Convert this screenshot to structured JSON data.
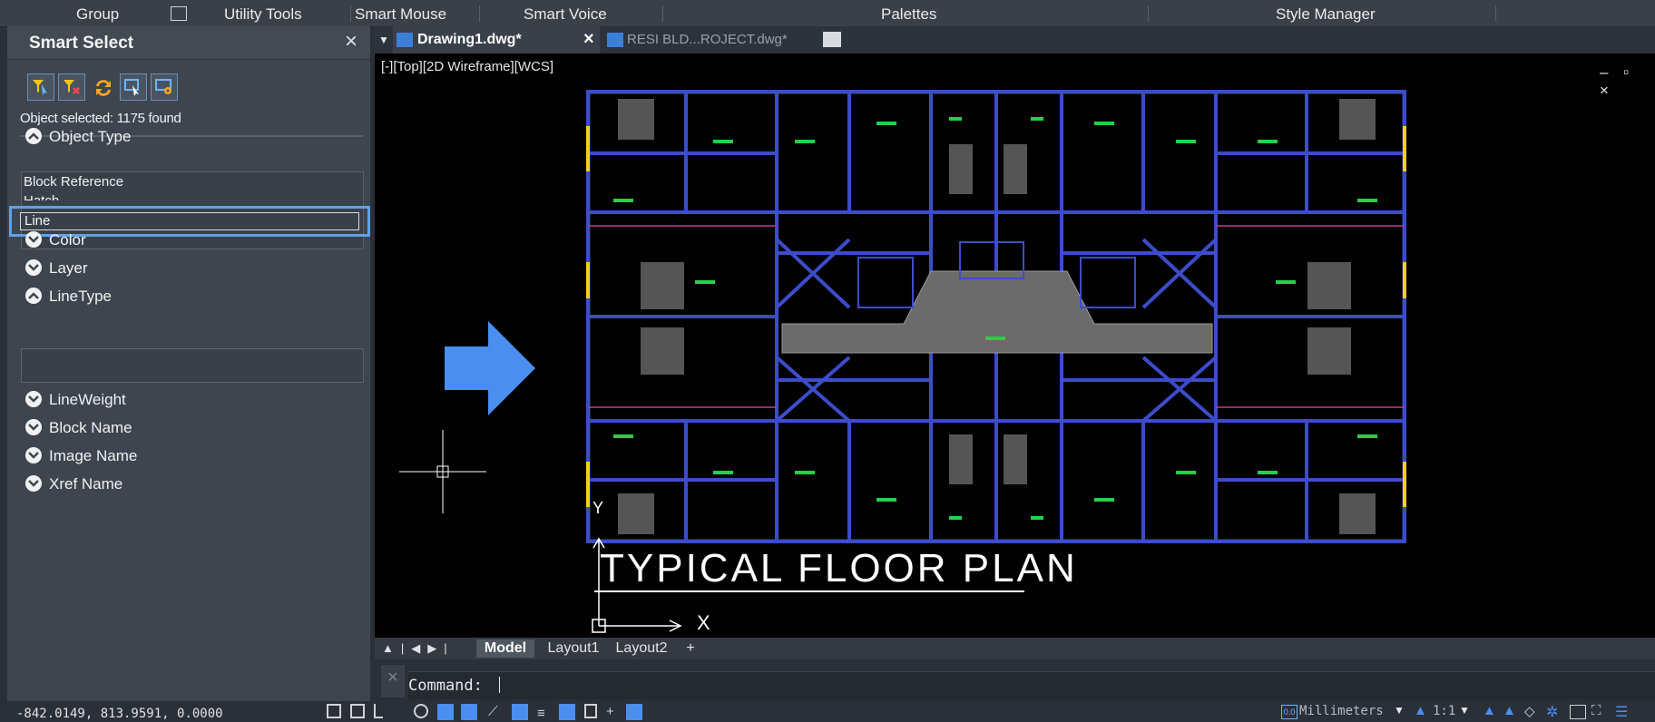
{
  "ribbon": {
    "items": [
      "Group",
      "Utility Tools",
      "Smart Mouse",
      "Smart Voice",
      "Palettes",
      "Style Manager"
    ]
  },
  "smart_select": {
    "title": "Smart Select",
    "close": "×",
    "status": "Object selected: 1175 found",
    "sections": [
      {
        "label": "Object Type",
        "expanded": true
      },
      {
        "label": "Color",
        "expanded": false
      },
      {
        "label": "Layer",
        "expanded": false
      },
      {
        "label": "LineType",
        "expanded": true
      },
      {
        "label": "LineWeight",
        "expanded": false
      },
      {
        "label": "Block Name",
        "expanded": false
      },
      {
        "label": "Image Name",
        "expanded": false
      },
      {
        "label": "Xref Name",
        "expanded": false
      }
    ],
    "object_types": [
      "Block Reference",
      "Hatch",
      "Line"
    ],
    "selected_type": "Line"
  },
  "tabs": [
    {
      "label": "Drawing1.dwg*",
      "active": true
    },
    {
      "label": "RESI BLD...ROJECT.dwg*",
      "active": false
    }
  ],
  "viewport": {
    "label": "[-][Top][2D Wireframe][WCS]",
    "window_controls": "– ▫ ×"
  },
  "drawing": {
    "title": "TYPICAL  FLOOR  PLAN",
    "axis_x": "X",
    "axis_y": "Y"
  },
  "layout_tabs": [
    "Model",
    "Layout1",
    "Layout2",
    "+"
  ],
  "command": {
    "prompt": "Command:",
    "value": ""
  },
  "status": {
    "coords": "-842.0149, 813.9591, 0.0000",
    "units": "Millimeters",
    "scale": "1:1"
  },
  "colors": {
    "accent_blue": "#4a8ef0",
    "wall_blue": "#3d4cc9",
    "furniture_green": "#23d14a",
    "selection_frame": "#5ea2e6"
  }
}
